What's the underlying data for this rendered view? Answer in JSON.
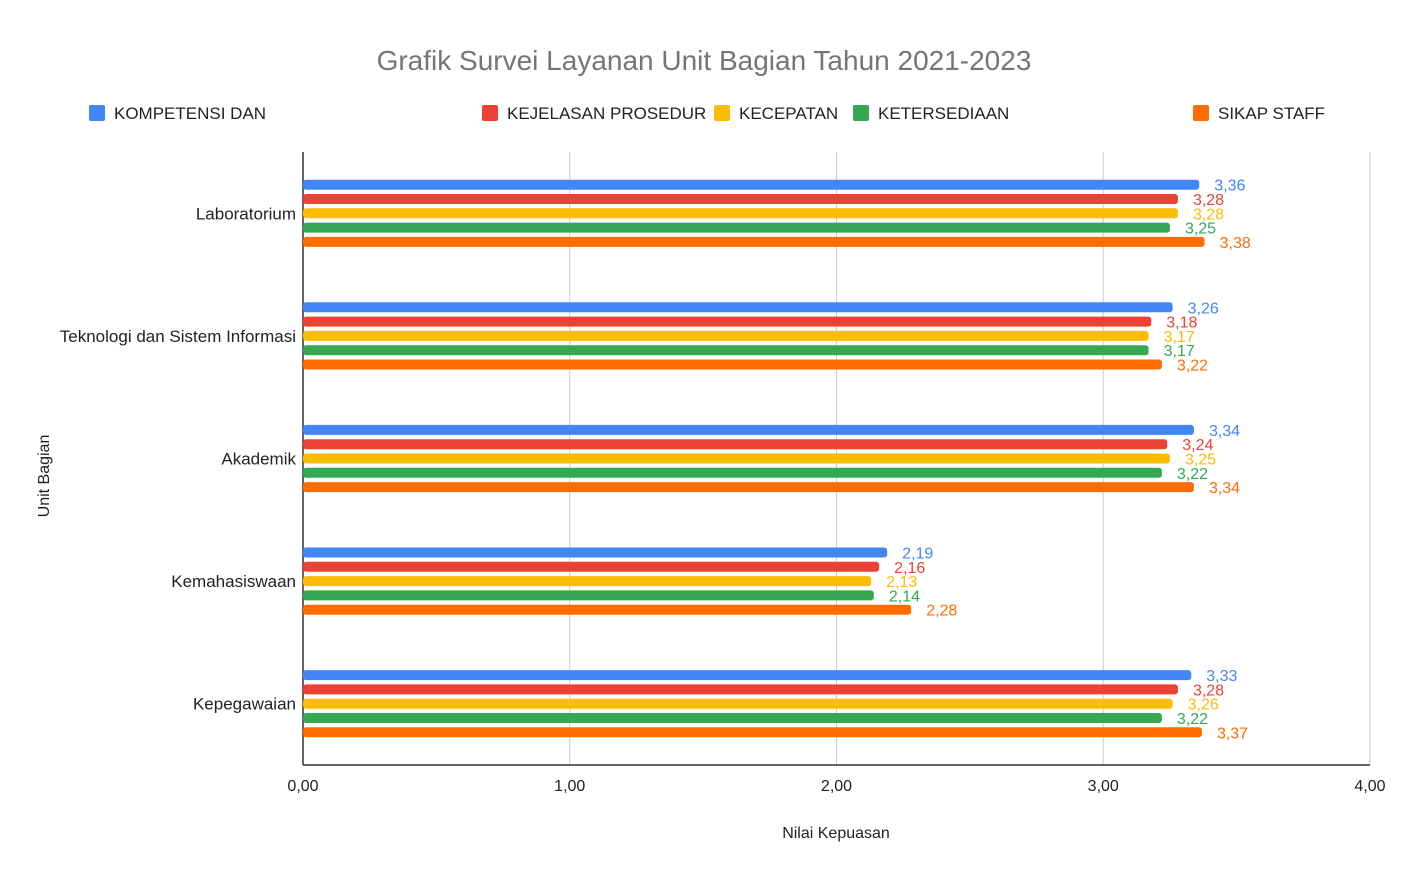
{
  "chart_data": {
    "type": "bar",
    "orientation": "horizontal",
    "title": "Grafik Survei Layanan Unit Bagian Tahun 2021-2023",
    "xlabel": "Nilai Kepuasan",
    "ylabel": "Unit Bagian",
    "xlim": [
      0,
      4
    ],
    "x_ticks": [
      "0,00",
      "1,00",
      "2,00",
      "3,00",
      "4,00"
    ],
    "grid": true,
    "legend_position": "top",
    "categories": [
      "Laboratorium",
      "Teknologi dan Sistem Informasi",
      "Akademik",
      "Kemahasiswaan",
      "Kepegawaian"
    ],
    "series": [
      {
        "name": "KOMPETENSI DAN",
        "color": "#4285f4",
        "values": [
          3.36,
          3.26,
          3.34,
          2.19,
          3.33
        ],
        "labels": [
          "3,36",
          "3,26",
          "3,34",
          "2,19",
          "3,33"
        ]
      },
      {
        "name": "KEJELASAN PROSEDUR",
        "color": "#ea4335",
        "values": [
          3.28,
          3.18,
          3.24,
          2.16,
          3.28
        ],
        "labels": [
          "3,28",
          "3,18",
          "3,24",
          "2,16",
          "3,28"
        ]
      },
      {
        "name": "KECEPATAN",
        "color": "#fbbc04",
        "values": [
          3.28,
          3.17,
          3.25,
          2.13,
          3.26
        ],
        "labels": [
          "3,28",
          "3,17",
          "3,25",
          "2,13",
          "3,26"
        ]
      },
      {
        "name": "KETERSEDIAAN",
        "color": "#34a853",
        "values": [
          3.25,
          3.17,
          3.22,
          2.14,
          3.22
        ],
        "labels": [
          "3,25",
          "3,17",
          "3,22",
          "2,14",
          "3,22"
        ]
      },
      {
        "name": "SIKAP STAFF",
        "color": "#ff6d01",
        "values": [
          3.38,
          3.22,
          3.34,
          2.28,
          3.37
        ],
        "labels": [
          "3,38",
          "3,22",
          "3,34",
          "2,28",
          "3,37"
        ]
      }
    ]
  }
}
